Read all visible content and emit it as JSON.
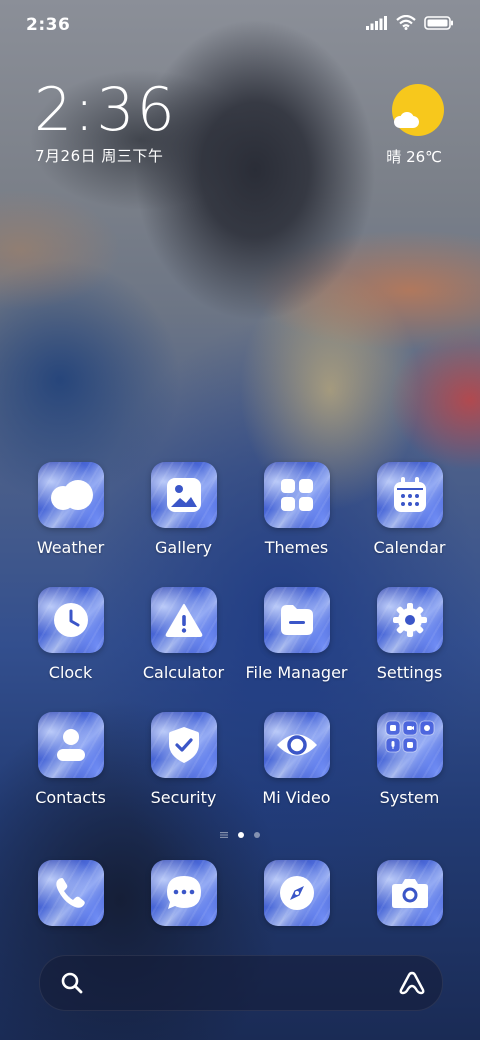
{
  "status_bar": {
    "time": "2:36"
  },
  "lockscreen_widget": {
    "clock": "2:36",
    "date": "7月26日 周三下午",
    "weather": "晴 26℃"
  },
  "apps": [
    {
      "label": "Weather"
    },
    {
      "label": "Gallery"
    },
    {
      "label": "Themes"
    },
    {
      "label": "Calendar"
    },
    {
      "label": "Clock"
    },
    {
      "label": "Calculator"
    },
    {
      "label": "File Manager"
    },
    {
      "label": "Settings"
    },
    {
      "label": "Contacts"
    },
    {
      "label": "Security"
    },
    {
      "label": "Mi Video"
    },
    {
      "label": "System"
    }
  ],
  "dock": {
    "items": [
      "phone-icon",
      "messages-icon",
      "browser-icon",
      "camera-icon"
    ]
  },
  "search_bar": {
    "left_icon": "search-icon",
    "right_icon": "assistant-icon"
  },
  "page_indicator": {
    "pages": 2,
    "active": 1
  }
}
